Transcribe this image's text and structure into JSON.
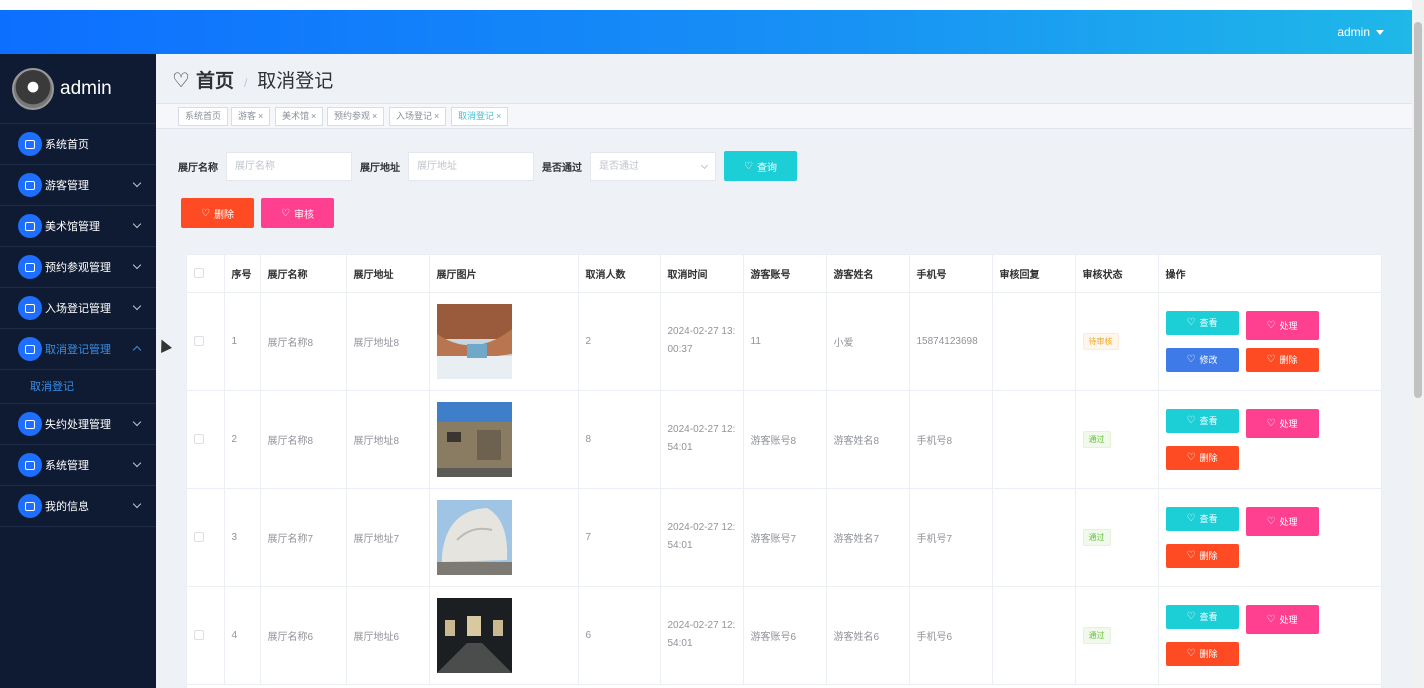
{
  "header": {
    "user": "admin"
  },
  "sidebar": {
    "brand": "admin",
    "items": [
      {
        "label": "系统首页",
        "icon": "home-icon"
      },
      {
        "label": "游客管理",
        "icon": "chart-icon"
      },
      {
        "label": "美术馆管理",
        "icon": "ticket-icon"
      },
      {
        "label": "预约参观管理",
        "icon": "user-icon"
      },
      {
        "label": "入场登记管理",
        "icon": "grid-icon"
      },
      {
        "label": "取消登记管理",
        "icon": "grid-icon"
      },
      {
        "label": "失约处理管理",
        "icon": "chat-icon"
      },
      {
        "label": "系统管理",
        "icon": "monitor-icon"
      },
      {
        "label": "我的信息",
        "icon": "card-icon"
      }
    ],
    "submenu": {
      "label": "取消登记"
    }
  },
  "breadcrumb": {
    "home": "首页",
    "sep": "/",
    "current": "取消登记"
  },
  "tags": [
    {
      "label": "系统首页",
      "closable": false
    },
    {
      "label": "游客",
      "closable": true
    },
    {
      "label": "美术馆",
      "closable": true
    },
    {
      "label": "预约参观",
      "closable": true
    },
    {
      "label": "入场登记",
      "closable": true
    },
    {
      "label": "取消登记",
      "closable": true,
      "active": true
    }
  ],
  "search": {
    "name_label": "展厅名称",
    "name_placeholder": "展厅名称",
    "addr_label": "展厅地址",
    "addr_placeholder": "展厅地址",
    "pass_label": "是否通过",
    "pass_placeholder": "是否通过",
    "query_button": "查询"
  },
  "actions": {
    "delete": "删除",
    "audit": "审核"
  },
  "table": {
    "columns": [
      "序号",
      "展厅名称",
      "展厅地址",
      "展厅图片",
      "取消人数",
      "取消时间",
      "游客账号",
      "游客姓名",
      "手机号",
      "审核回复",
      "审核状态",
      "操作"
    ],
    "rows": [
      {
        "no": "1",
        "name": "展厅名称8",
        "addr": "展厅地址8",
        "count": "2",
        "time": "2024-02-27 13:00:37",
        "account": "11",
        "visitor": "小爱",
        "phone": "15874123698",
        "reply": "",
        "status": "待审核"
      },
      {
        "no": "2",
        "name": "展厅名称8",
        "addr": "展厅地址8",
        "count": "8",
        "time": "2024-02-27 12:54:01",
        "account": "游客账号8",
        "visitor": "游客姓名8",
        "phone": "手机号8",
        "reply": "",
        "status": "通过"
      },
      {
        "no": "3",
        "name": "展厅名称7",
        "addr": "展厅地址7",
        "count": "7",
        "time": "2024-02-27 12:54:01",
        "account": "游客账号7",
        "visitor": "游客姓名7",
        "phone": "手机号7",
        "reply": "",
        "status": "通过"
      },
      {
        "no": "4",
        "name": "展厅名称6",
        "addr": "展厅地址6",
        "count": "6",
        "time": "2024-02-27 12:54:01",
        "account": "游客账号6",
        "visitor": "游客姓名6",
        "phone": "手机号6",
        "reply": "",
        "status": "通过"
      }
    ],
    "ops": {
      "view": "查看",
      "handle": "处理",
      "edit": "修改",
      "delete": "删除"
    }
  },
  "colors": {
    "primary": "#1e6fff",
    "sidebar": "#0f1b33",
    "teal": "#1ccfd6",
    "pink": "#ff3f8f",
    "orange_red": "#ff4b24",
    "blue": "#3e7be8"
  }
}
